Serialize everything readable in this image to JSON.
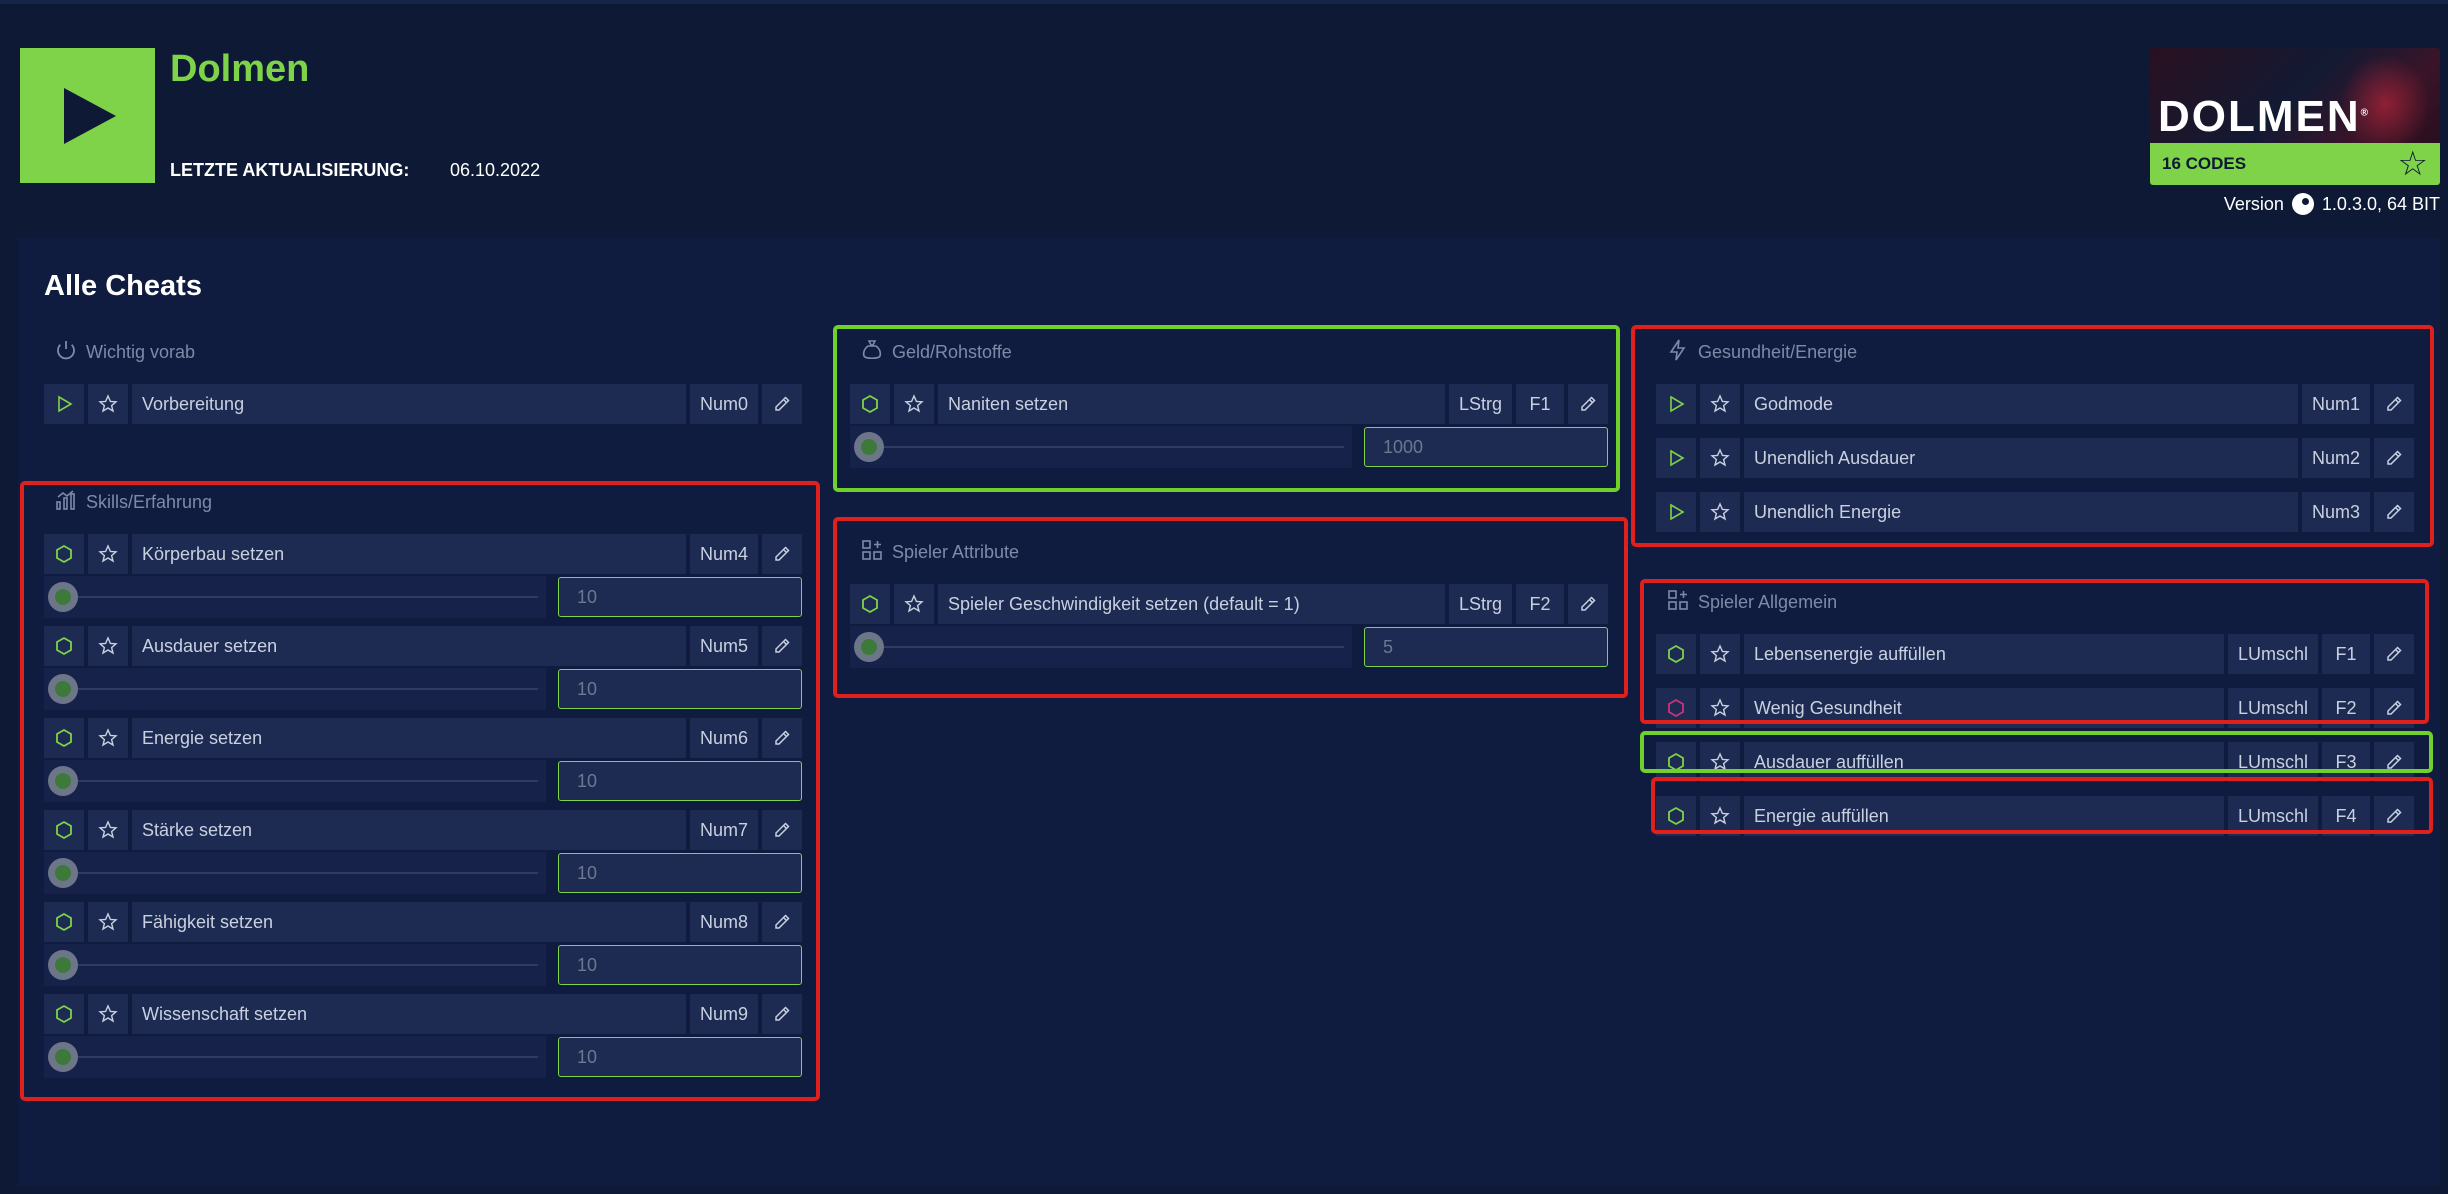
{
  "game": {
    "title": "Dolmen",
    "update_label": "LETZTE AKTUALISIERUNG:",
    "update_date": "06.10.2022",
    "cover_logo": "DOLMEN",
    "codes": "16 CODES",
    "version_label": "Version",
    "version_value": "1.0.3.0, 64 BIT"
  },
  "main": {
    "title": "Alle Cheats"
  },
  "groups": {
    "wichtig": {
      "title": "Wichtig vorab",
      "icon": "power-icon",
      "items": [
        {
          "label": "Vorbereitung",
          "key1": "Num0",
          "type": "toggle"
        }
      ]
    },
    "skills": {
      "title": "Skills/Erfahrung",
      "icon": "chart-icon",
      "items": [
        {
          "label": "Körperbau setzen",
          "key1": "Num4",
          "value": "10",
          "slider_level": 0
        },
        {
          "label": "Ausdauer setzen",
          "key1": "Num5",
          "value": "10",
          "slider_level": 0
        },
        {
          "label": "Energie setzen",
          "key1": "Num6",
          "value": "10",
          "slider_level": 0
        },
        {
          "label": "Stärke setzen",
          "key1": "Num7",
          "value": "10",
          "slider_level": 0
        },
        {
          "label": "Fähigkeit setzen",
          "key1": "Num8",
          "value": "10",
          "slider_level": 0
        },
        {
          "label": "Wissenschaft setzen",
          "key1": "Num9",
          "value": "10",
          "slider_level": 0
        }
      ]
    },
    "geld": {
      "title": "Geld/Rohstoffe",
      "icon": "moneybag-icon",
      "items": [
        {
          "label": "Naniten setzen",
          "key1": "LStrg",
          "key2": "F1",
          "value": "1000",
          "slider_level": 0
        }
      ]
    },
    "attribute": {
      "title": "Spieler Attribute",
      "icon": "grid-plus-icon",
      "items": [
        {
          "label": "Spieler Geschwindigkeit setzen (default = 1)",
          "key1": "LStrg",
          "key2": "F2",
          "value": "5",
          "slider_level": 0
        }
      ]
    },
    "gesundheit": {
      "title": "Gesundheit/Energie",
      "icon": "lightning-icon",
      "items": [
        {
          "label": "Godmode",
          "key1": "Num1"
        },
        {
          "label": "Unendlich Ausdauer",
          "key1": "Num2"
        },
        {
          "label": "Unendlich Energie",
          "key1": "Num3"
        }
      ]
    },
    "allgemein": {
      "title": "Spieler Allgemein",
      "icon": "grid-plus-icon",
      "items": [
        {
          "label": "Lebensenergie auffüllen",
          "key1": "LUmschl",
          "key2": "F1"
        },
        {
          "label": "Wenig Gesundheit",
          "key1": "LUmschl",
          "key2": "F2"
        },
        {
          "label": "Ausdauer auffüllen",
          "key1": "LUmschl",
          "key2": "F3"
        },
        {
          "label": "Energie auffüllen",
          "key1": "LUmschl",
          "key2": "F4"
        }
      ]
    }
  },
  "colors": {
    "accent": "#7ed348",
    "background": "#0d1935",
    "panel": "#0f1c3f",
    "cell": "#1d2b52",
    "highlight_red": "#e0201c",
    "highlight_green": "#6fd12a",
    "hex_pink": "#d0307a"
  }
}
